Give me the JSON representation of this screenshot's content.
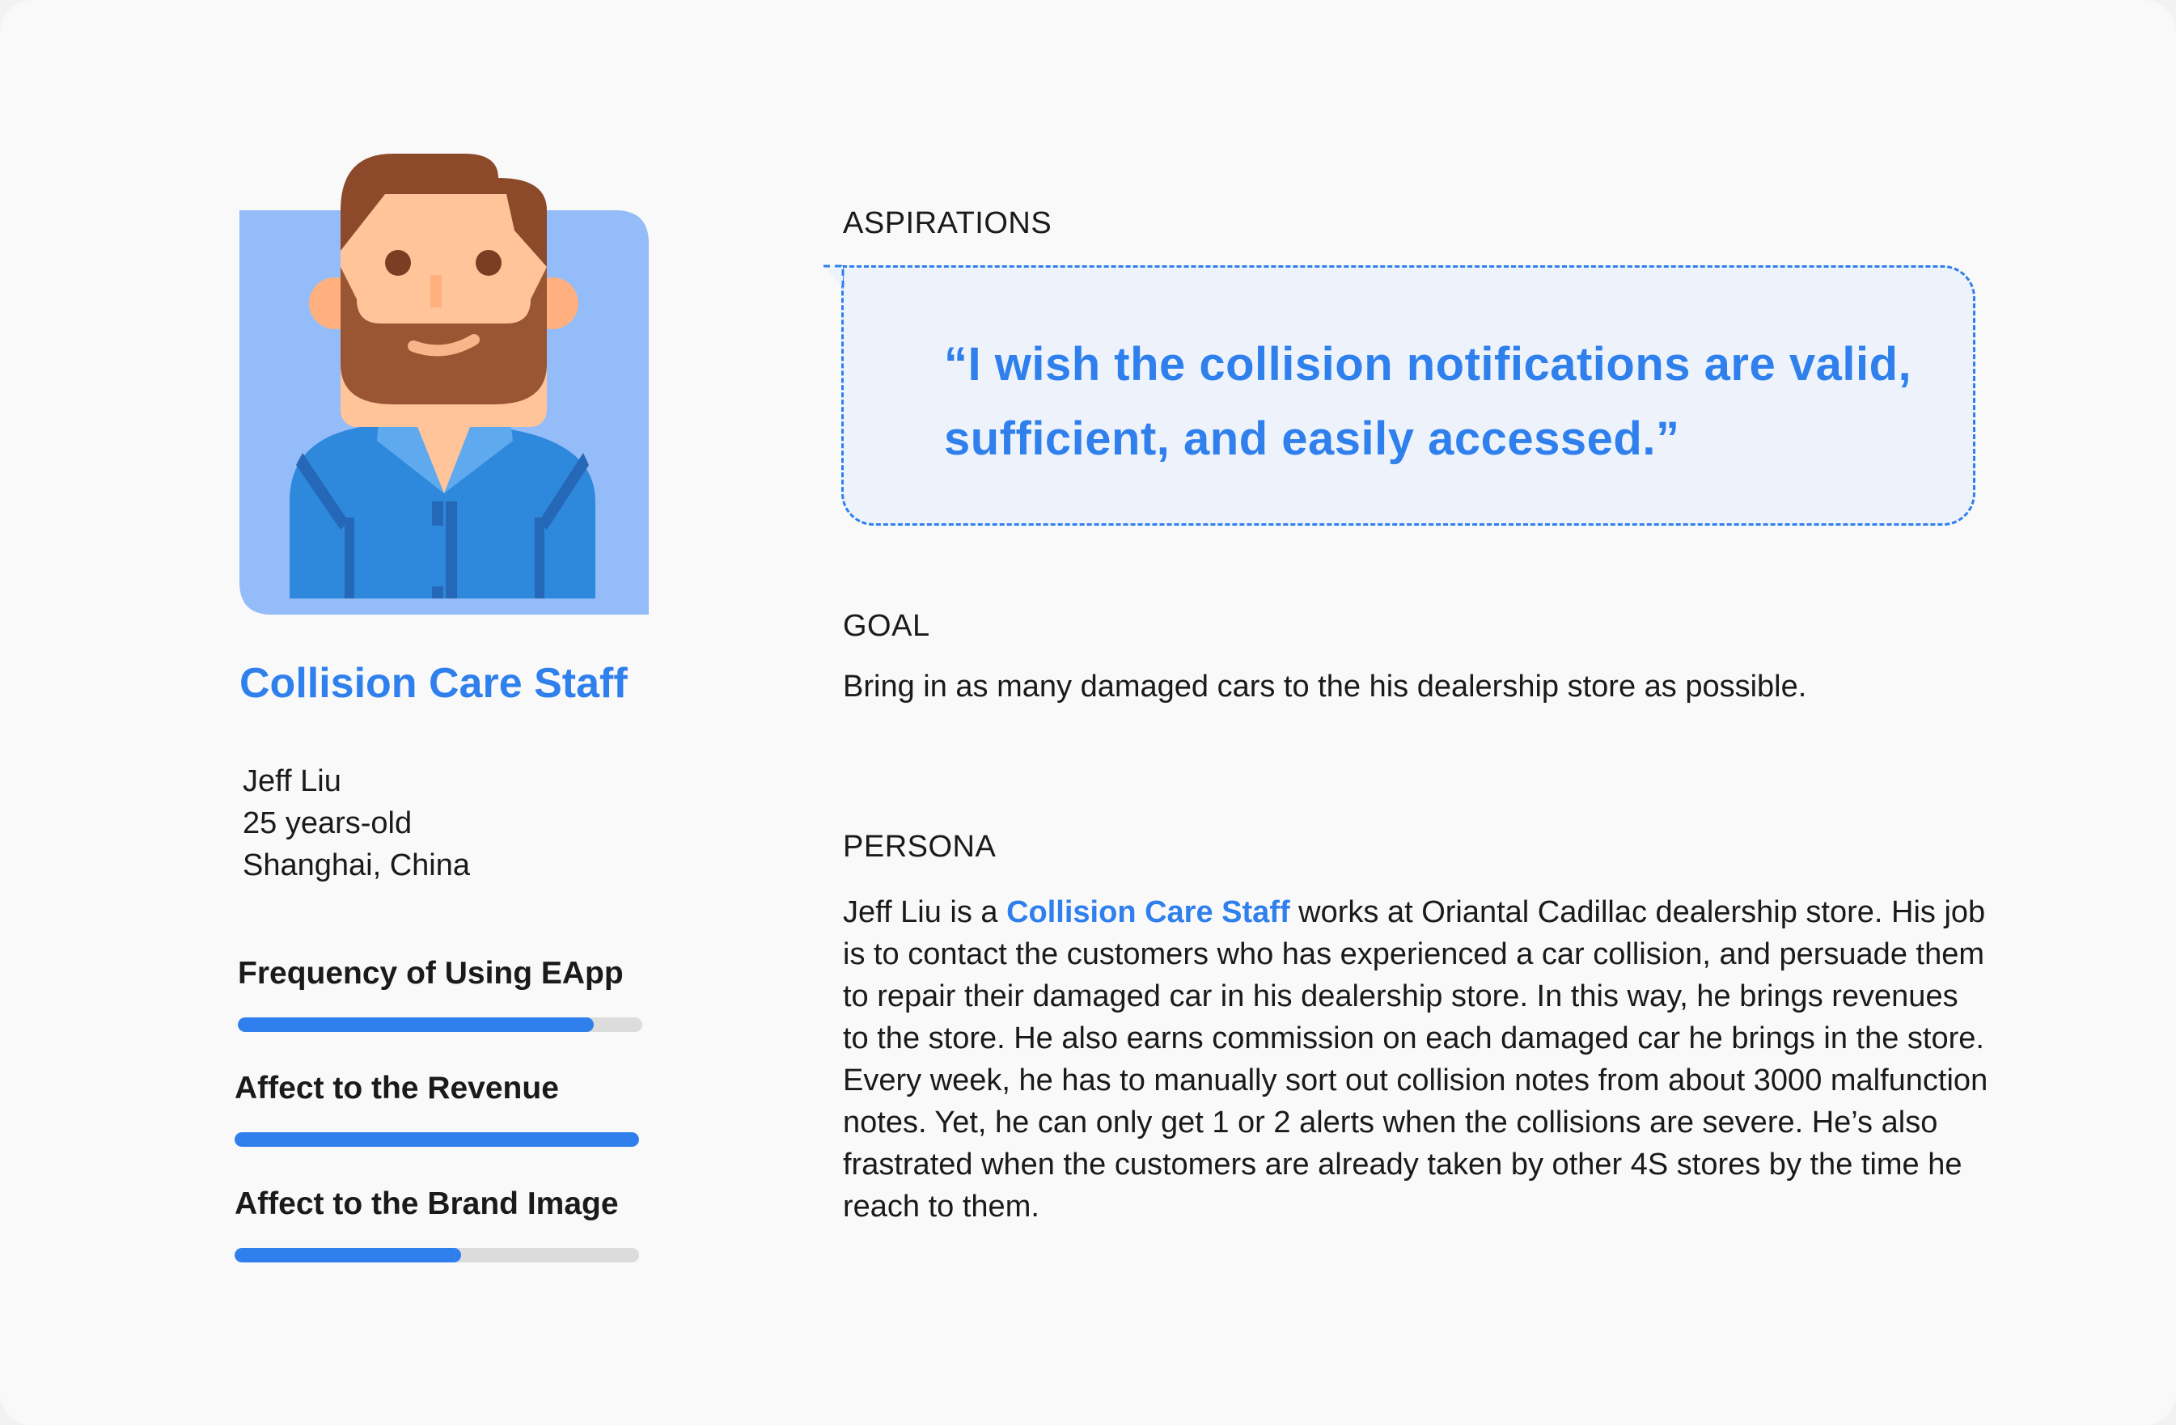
{
  "persona_card": {
    "role_title": "Collision Care Staff",
    "profile": {
      "name": "Jeff Liu",
      "age": "25 years-old",
      "location": "Shanghai, China"
    },
    "metrics": [
      {
        "label": "Frequency of Using EApp",
        "level": 0.88
      },
      {
        "label": "Affect to the Revenue",
        "level": 1.0
      },
      {
        "label": "Affect to the Brand Image",
        "level": 0.56
      }
    ],
    "avatar_icon": "bearded-man-avatar-icon"
  },
  "aspirations": {
    "heading": "ASPIRATIONS",
    "quote": "“I wish the collision notifications are valid, sufficient, and easily accessed.”"
  },
  "goal": {
    "heading": "GOAL",
    "text": "Bring in as many damaged cars to the his dealership store as possible."
  },
  "persona": {
    "heading": "PERSONA",
    "text_before": "Jeff Liu is a ",
    "highlight": "Collision Care Staff",
    "text_after": " works at Oriantal Cadillac dealership store. His job is to contact the customers who has experienced a car collision, and persuade them to repair their damaged car in his dealership store. In this way, he brings revenues to the store. He also earns commission on each damaged car he brings in the store. Every week, he has to manually sort out collision notes from about 3000 malfunction notes. Yet, he can only get 1 or 2 alerts when the collisions are severe. He’s also frastrated when the customers are already taken by other 4S stores by the time he reach to them."
  },
  "colors": {
    "accent": "#2f80ed",
    "avatar_bg": "#94bcf8",
    "quote_bg": "#eef3fb",
    "track": "#dcdcdc"
  }
}
